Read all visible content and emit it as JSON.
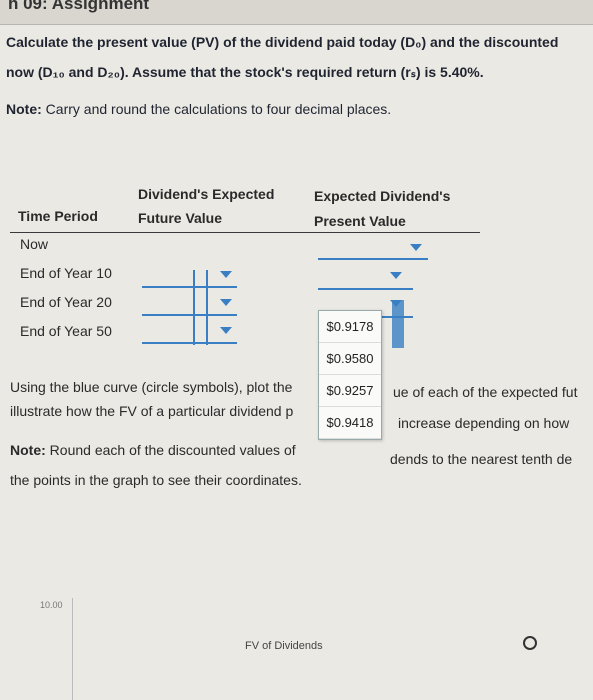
{
  "header": {
    "title": "h 09: Assignment"
  },
  "question": {
    "line1": "Calculate the present value (PV) of the dividend paid today (D₀) and the discounted",
    "line2": "now (D₁₀ and D₂₀). Assume that the stock's required return (rₛ) is 5.40%.",
    "note_label": "Note:",
    "note_text": " Carry and round the calculations to four decimal places."
  },
  "table": {
    "col_period": "Time Period",
    "col_fv_line1": "Dividend's Expected",
    "col_fv_line2": "Future Value",
    "col_pv_line1": "Expected Dividend's",
    "col_pv_line2": "Present Value",
    "rows": [
      "Now",
      "End of Year 10",
      "End of Year 20",
      "End of Year 50"
    ]
  },
  "dropdown_menu": {
    "options": [
      "$0.9178",
      "$0.9580",
      "$0.9257",
      "$0.9418"
    ]
  },
  "paragraph": {
    "line1_left": "Using the blue curve (circle symbols), plot the",
    "line1_right": "ue of each of the expected fut",
    "line2_left": "illustrate how the FV of a particular dividend p",
    "line2_right": "increase depending on how",
    "note_label": "Note:",
    "note_left": " Round each of the discounted values of",
    "note_right": "dends to the nearest tenth de",
    "line4": "the points in the graph to see their coordinates."
  },
  "graph": {
    "y_tick": "10.00",
    "title": "FV of Dividends"
  },
  "colors": {
    "accent": "#3a7fc4",
    "background": "#ebe9e4"
  }
}
